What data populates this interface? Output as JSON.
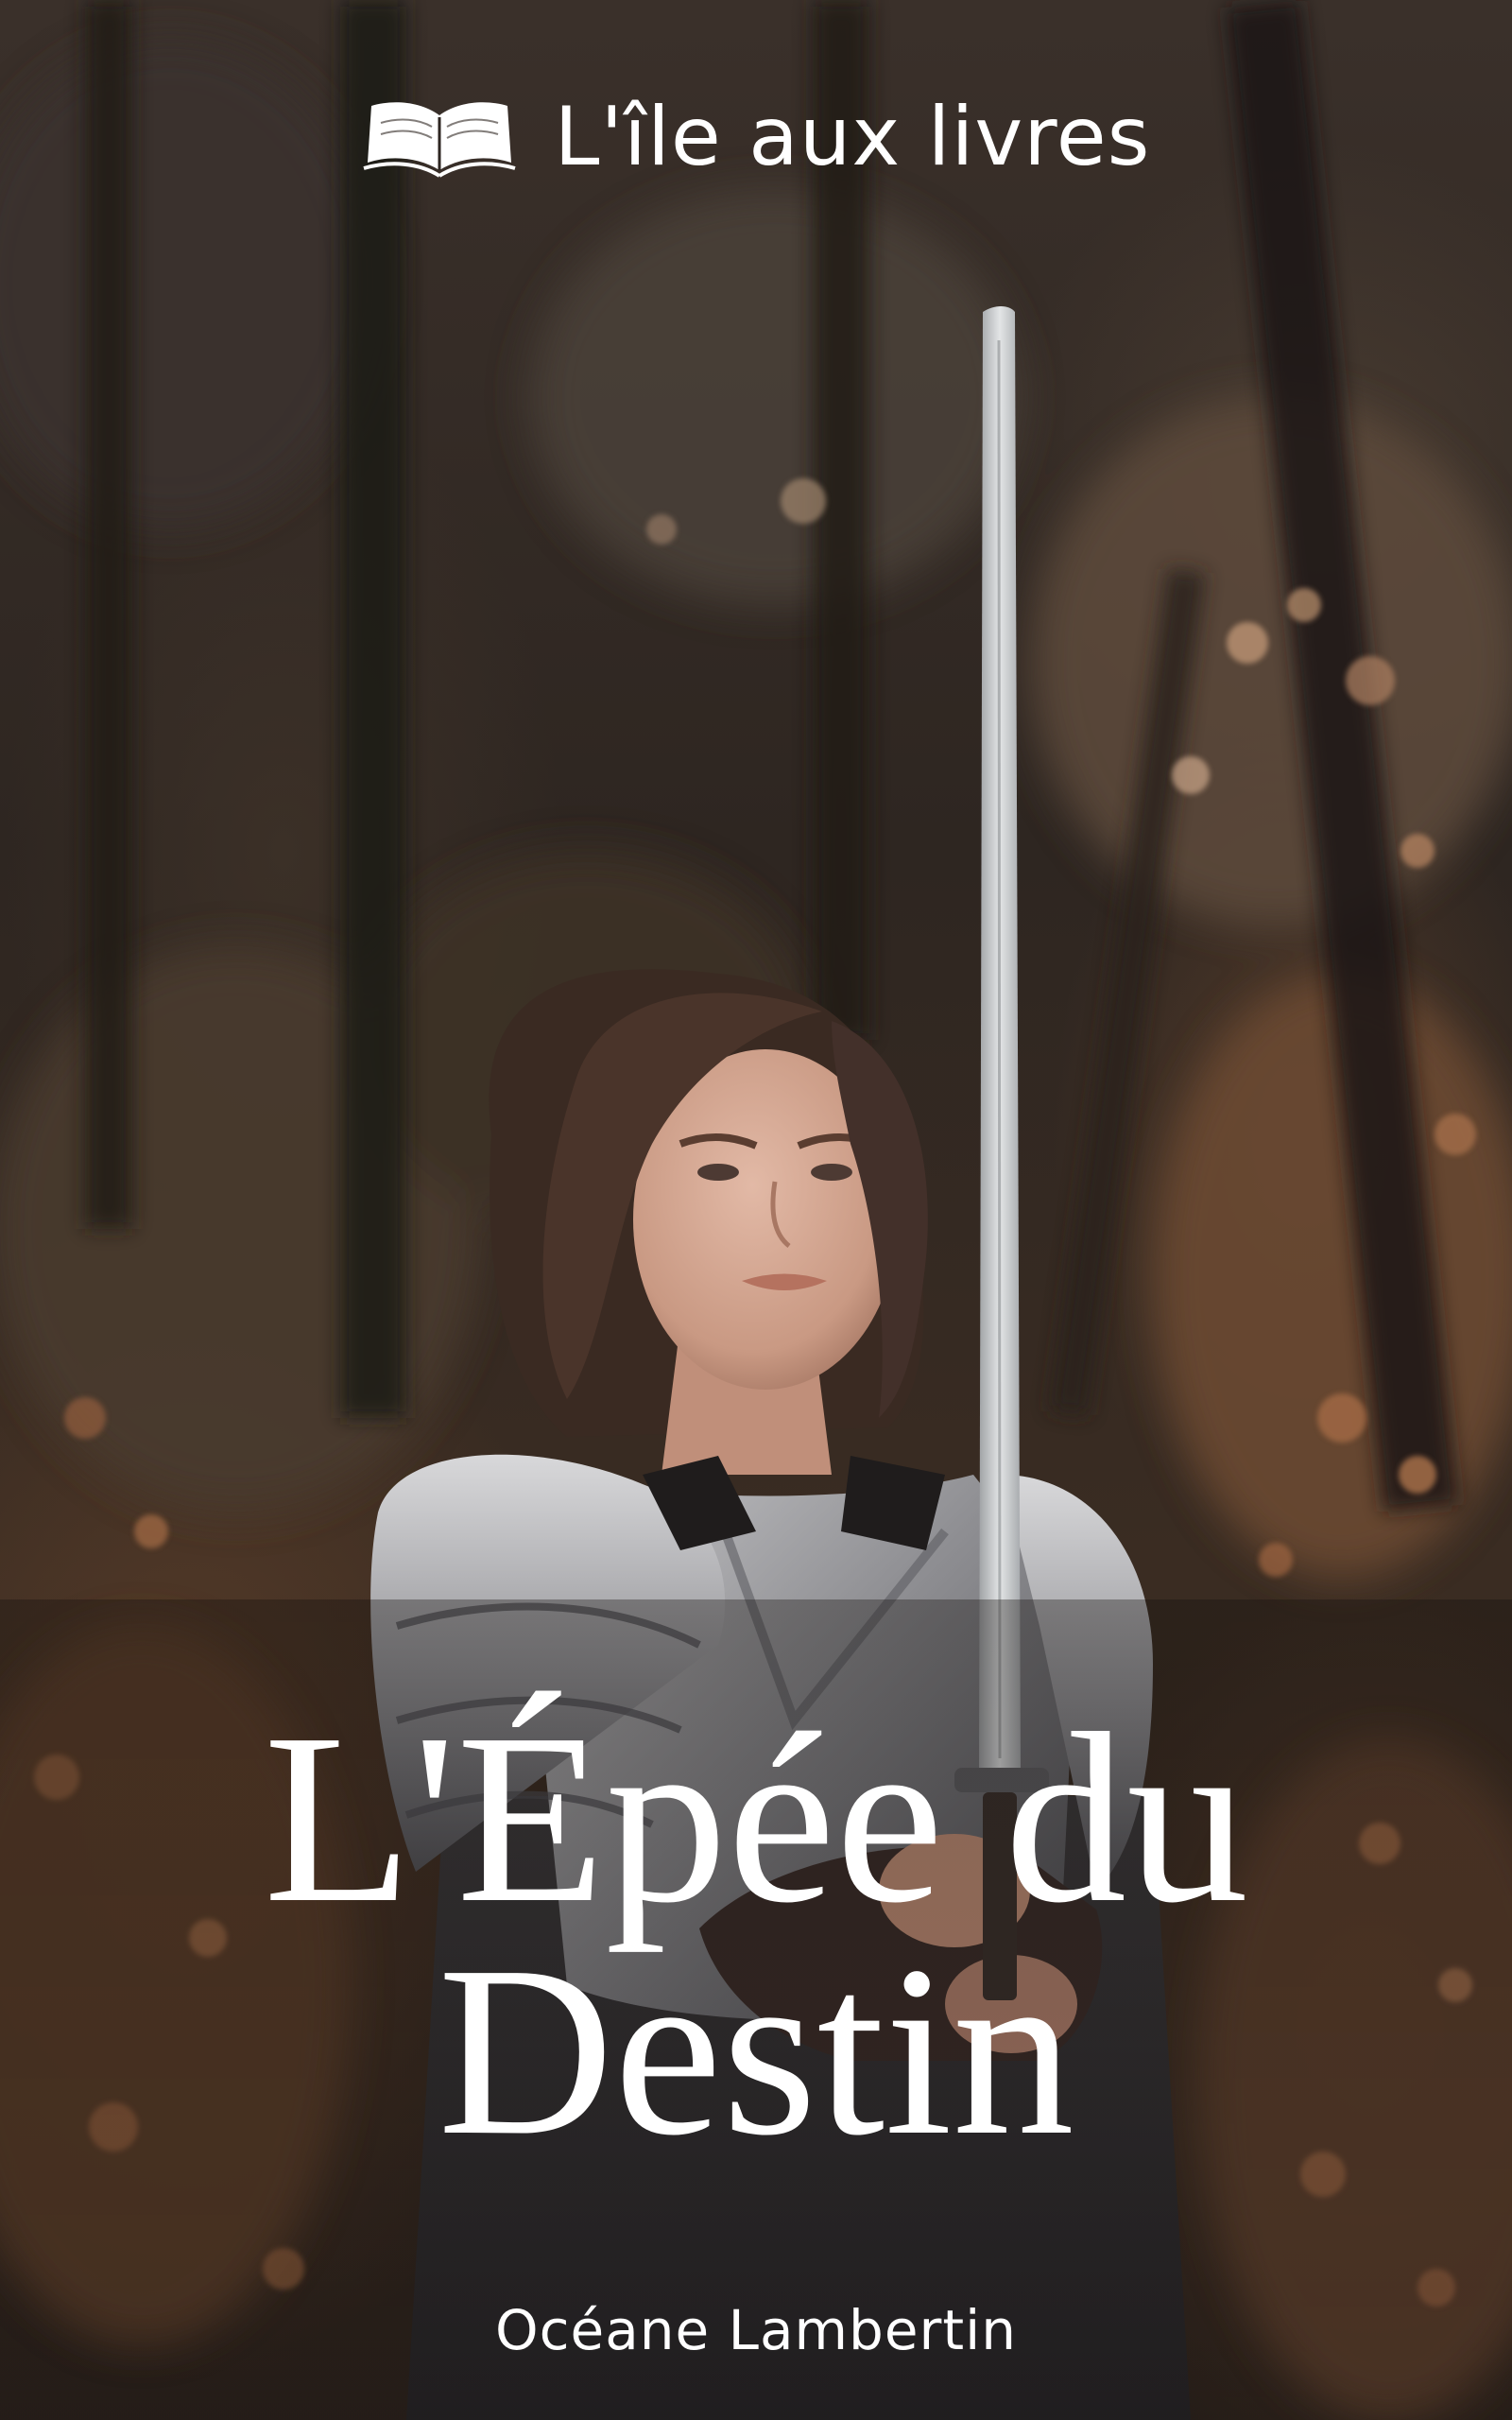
{
  "publisher": {
    "name": "L'île aux livres",
    "logo_icon": "open-book-icon"
  },
  "cover": {
    "title_line1": "L'Épée du",
    "title_line2": "Destin",
    "author": "Océane Lambertin"
  },
  "colors": {
    "text": "#ffffff",
    "armor": "#9a9a9c",
    "leaves": "#8a5a3a",
    "forest_dark": "#2e2621"
  }
}
